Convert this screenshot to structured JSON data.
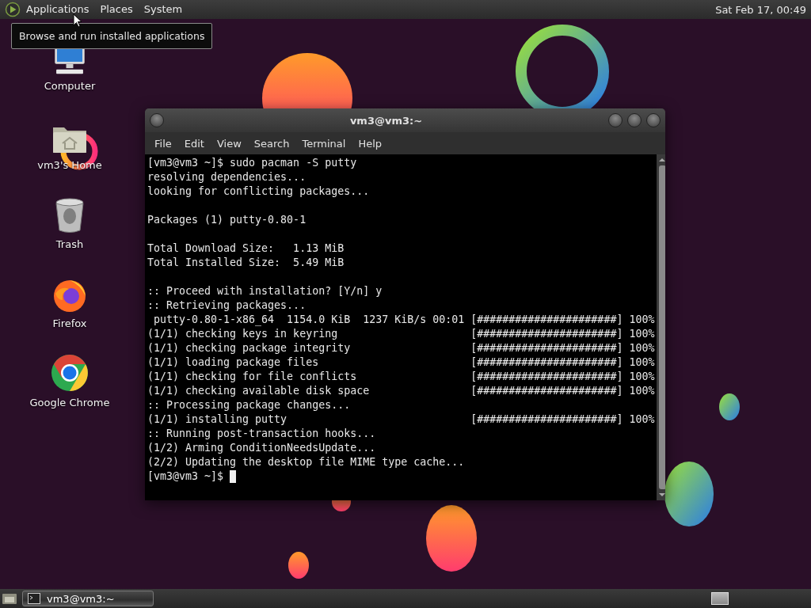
{
  "top_panel": {
    "menus": [
      "Applications",
      "Places",
      "System"
    ],
    "clock": "Sat Feb 17, 00:49"
  },
  "tooltip": "Browse and run installed applications",
  "desktop_icons": [
    {
      "label": "Computer",
      "kind": "computer"
    },
    {
      "label": "vm3's Home",
      "kind": "home"
    },
    {
      "label": "Trash",
      "kind": "trash"
    },
    {
      "label": "Firefox",
      "kind": "firefox"
    },
    {
      "label": "Google Chrome",
      "kind": "chrome"
    }
  ],
  "terminal": {
    "title": "vm3@vm3:~",
    "menus": [
      "File",
      "Edit",
      "View",
      "Search",
      "Terminal",
      "Help"
    ],
    "lines": [
      {
        "kind": "text",
        "text": "[vm3@vm3 ~]$ sudo pacman -S putty"
      },
      {
        "kind": "text",
        "text": "resolving dependencies..."
      },
      {
        "kind": "text",
        "text": "looking for conflicting packages..."
      },
      {
        "kind": "blank"
      },
      {
        "kind": "text",
        "text": "Packages (1) putty-0.80-1"
      },
      {
        "kind": "blank"
      },
      {
        "kind": "text",
        "text": "Total Download Size:   1.13 MiB"
      },
      {
        "kind": "text",
        "text": "Total Installed Size:  5.49 MiB"
      },
      {
        "kind": "blank"
      },
      {
        "kind": "text",
        "text": ":: Proceed with installation? [Y/n] y"
      },
      {
        "kind": "text",
        "text": ":: Retrieving packages..."
      },
      {
        "kind": "text",
        "text": " putty-0.80-1-x86_64  1154.0 KiB  1237 KiB/s 00:01",
        "progress": "[######################] 100%"
      },
      {
        "kind": "text",
        "text": "(1/1) checking keys in keyring",
        "progress": "[######################] 100%"
      },
      {
        "kind": "text",
        "text": "(1/1) checking package integrity",
        "progress": "[######################] 100%"
      },
      {
        "kind": "text",
        "text": "(1/1) loading package files",
        "progress": "[######################] 100%"
      },
      {
        "kind": "text",
        "text": "(1/1) checking for file conflicts",
        "progress": "[######################] 100%"
      },
      {
        "kind": "text",
        "text": "(1/1) checking available disk space",
        "progress": "[######################] 100%"
      },
      {
        "kind": "text",
        "text": ":: Processing package changes..."
      },
      {
        "kind": "text",
        "text": "(1/1) installing putty",
        "progress": "[######################] 100%"
      },
      {
        "kind": "text",
        "text": ":: Running post-transaction hooks..."
      },
      {
        "kind": "text",
        "text": "(1/2) Arming ConditionNeedsUpdate..."
      },
      {
        "kind": "text",
        "text": "(2/2) Updating the desktop file MIME type cache..."
      },
      {
        "kind": "prompt",
        "text": "[vm3@vm3 ~]$"
      }
    ]
  },
  "taskbar": {
    "tasks": [
      {
        "label": "vm3@vm3:~",
        "selected": true
      }
    ]
  }
}
